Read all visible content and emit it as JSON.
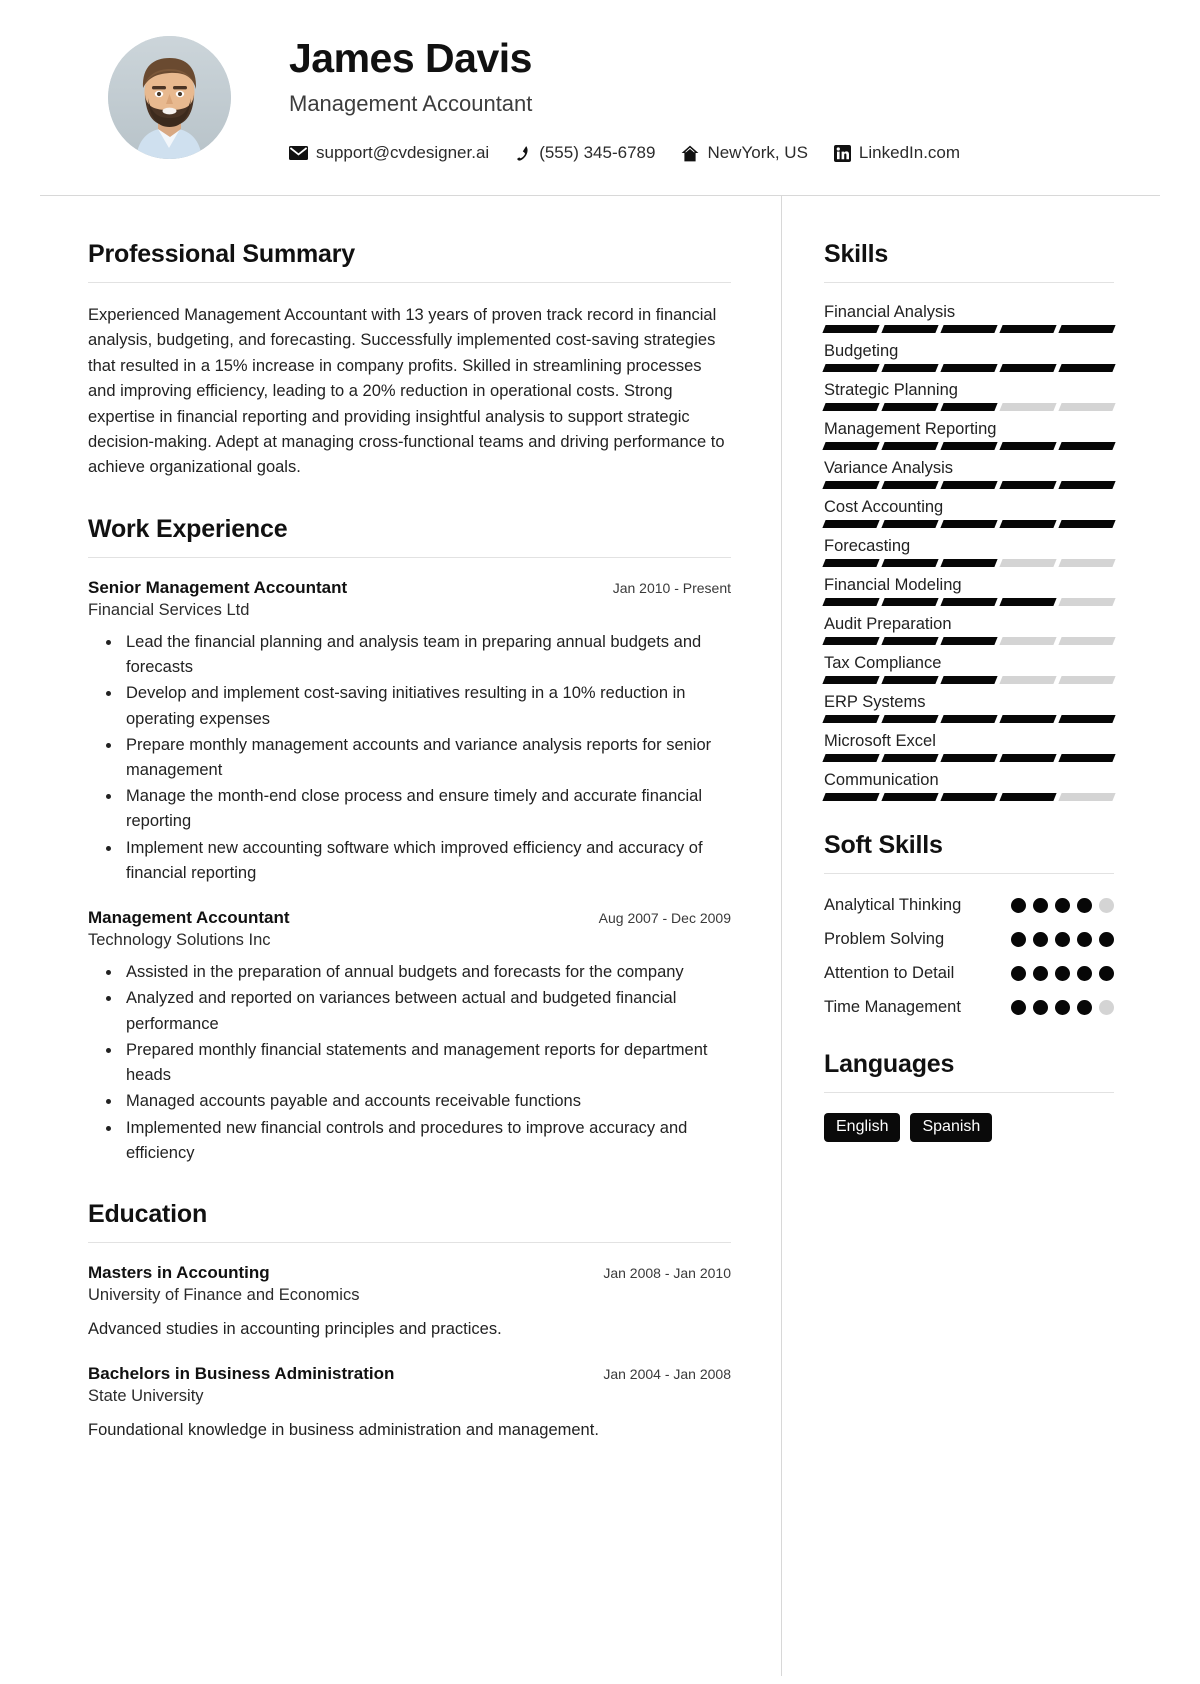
{
  "header": {
    "name": "James Davis",
    "job_title": "Management Accountant",
    "avatar_alt": "profile-photo",
    "contacts": [
      {
        "icon": "envelope-icon",
        "text": "support@cvdesigner.ai"
      },
      {
        "icon": "phone-icon",
        "text": "(555) 345-6789"
      },
      {
        "icon": "home-icon",
        "text": "NewYork, US"
      },
      {
        "icon": "linkedin-icon",
        "text": "LinkedIn.com"
      }
    ]
  },
  "summary": {
    "title": "Professional Summary",
    "text": "Experienced Management Accountant with 13 years of proven track record in financial analysis, budgeting, and forecasting. Successfully implemented cost-saving strategies that resulted in a 15% increase in company profits. Skilled in streamlining processes and improving efficiency, leading to a 20% reduction in operational costs. Strong expertise in financial reporting and providing insightful analysis to support strategic decision-making. Adept at managing cross-functional teams and driving performance to achieve organizational goals."
  },
  "experience": {
    "title": "Work Experience",
    "entries": [
      {
        "role": "Senior Management Accountant",
        "date": "Jan 2010 - Present",
        "company": "Financial Services Ltd",
        "bullets": [
          "Lead the financial planning and analysis team in preparing annual budgets and forecasts",
          "Develop and implement cost-saving initiatives resulting in a 10% reduction in operating expenses",
          "Prepare monthly management accounts and variance analysis reports for senior management",
          "Manage the month-end close process and ensure timely and accurate financial reporting",
          "Implement new accounting software which improved efficiency and accuracy of financial reporting"
        ]
      },
      {
        "role": "Management Accountant",
        "date": "Aug 2007 - Dec 2009",
        "company": "Technology Solutions Inc",
        "bullets": [
          "Assisted in the preparation of annual budgets and forecasts for the company",
          "Analyzed and reported on variances between actual and budgeted financial performance",
          "Prepared monthly financial statements and management reports for department heads",
          "Managed accounts payable and accounts receivable functions",
          "Implemented new financial controls and procedures to improve accuracy and efficiency"
        ]
      }
    ]
  },
  "education": {
    "title": "Education",
    "entries": [
      {
        "degree": "Masters in Accounting",
        "date": "Jan 2008 - Jan 2010",
        "school": "University of Finance and Economics",
        "desc": "Advanced studies in accounting principles and practices."
      },
      {
        "degree": "Bachelors in Business Administration",
        "date": "Jan 2004 - Jan 2008",
        "school": "State University",
        "desc": "Foundational knowledge in business administration and management."
      }
    ]
  },
  "skills": {
    "title": "Skills",
    "max_level": 5,
    "items": [
      {
        "name": "Financial Analysis",
        "level": 5
      },
      {
        "name": "Budgeting",
        "level": 5
      },
      {
        "name": "Strategic Planning",
        "level": 3
      },
      {
        "name": "Management Reporting",
        "level": 5
      },
      {
        "name": "Variance Analysis",
        "level": 5
      },
      {
        "name": "Cost Accounting",
        "level": 5
      },
      {
        "name": "Forecasting",
        "level": 3
      },
      {
        "name": "Financial Modeling",
        "level": 4
      },
      {
        "name": "Audit Preparation",
        "level": 3
      },
      {
        "name": "Tax Compliance",
        "level": 3
      },
      {
        "name": "ERP Systems",
        "level": 5
      },
      {
        "name": "Microsoft Excel",
        "level": 5
      },
      {
        "name": "Communication",
        "level": 4
      }
    ]
  },
  "soft_skills": {
    "title": "Soft Skills",
    "max_level": 5,
    "items": [
      {
        "name": "Analytical Thinking",
        "level": 4
      },
      {
        "name": "Problem Solving",
        "level": 5
      },
      {
        "name": "Attention to Detail",
        "level": 5
      },
      {
        "name": "Time Management",
        "level": 4
      }
    ]
  },
  "languages": {
    "title": "Languages",
    "items": [
      "English",
      "Spanish"
    ]
  },
  "colors": {
    "accent": "#070707",
    "muted_bar": "#d4d4d4",
    "rule": "#e2e2e2",
    "text": "#222222"
  }
}
